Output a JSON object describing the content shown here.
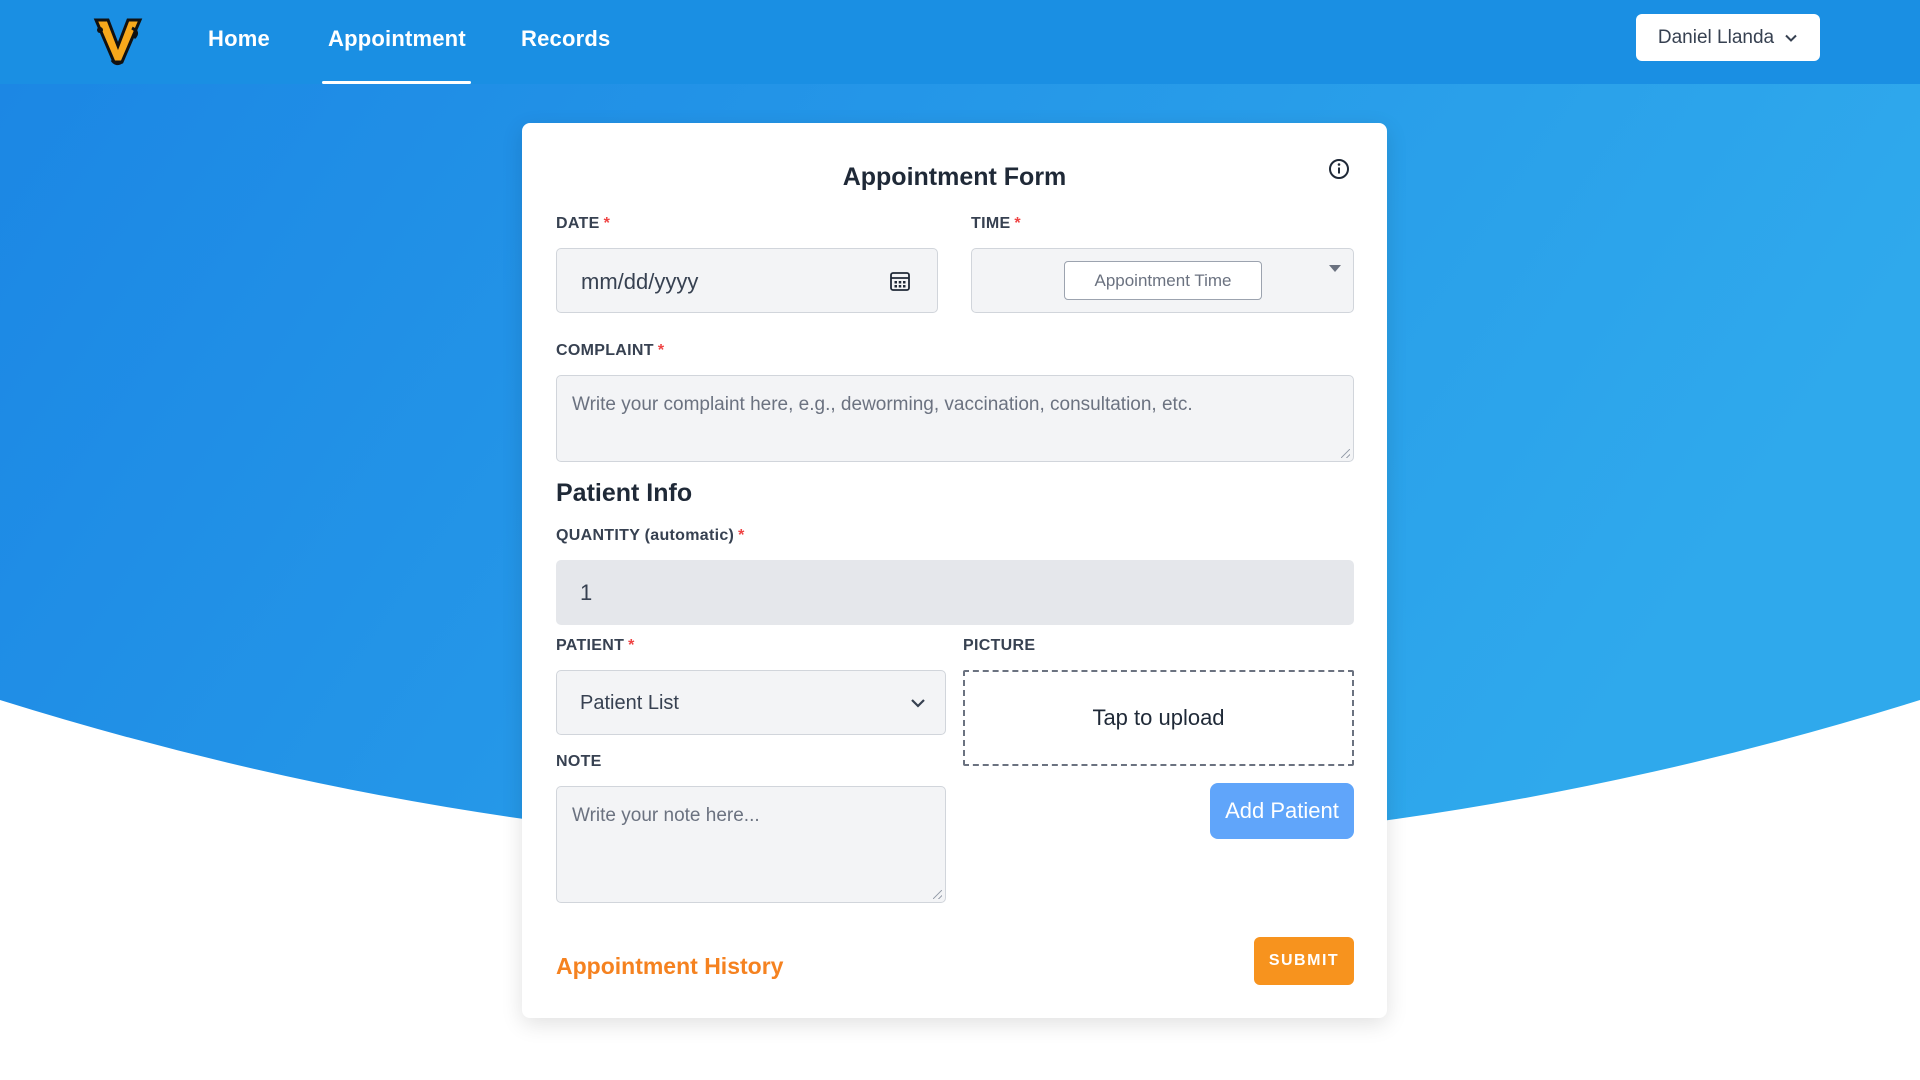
{
  "nav": {
    "links": [
      {
        "label": "Home"
      },
      {
        "label": "Appointment",
        "active": true
      },
      {
        "label": "Records"
      }
    ],
    "user_name": "Daniel Llanda",
    "logo_letter": "V"
  },
  "form": {
    "title": "Appointment Form",
    "date": {
      "label": "DATE",
      "placeholder": "mm/dd/yyyy"
    },
    "time": {
      "label": "TIME",
      "placeholder": "Appointment Time"
    },
    "complaint": {
      "label": "COMPLAINT",
      "placeholder": "Write your complaint here, e.g., deworming, vaccination, consultation, etc."
    },
    "required_mark": "*",
    "patient_info": {
      "title": "Patient Info",
      "quantity": {
        "label": "QUANTITY (automatic)",
        "value": "1"
      },
      "patient": {
        "label": "PATIENT",
        "selected": "Patient List"
      },
      "picture": {
        "label": "PICTURE",
        "upload_text": "Tap to upload"
      },
      "note": {
        "label": "NOTE",
        "placeholder": "Write your note here..."
      },
      "add_button": "Add Patient"
    },
    "history_link": "Appointment History",
    "submit_label": "SUBMIT"
  },
  "colors": {
    "brand_blue": "#1a8fe3",
    "accent_orange": "#f7931e",
    "link_orange": "#f58220",
    "add_button_blue": "#60a5fa",
    "required_red": "#ef4444"
  }
}
